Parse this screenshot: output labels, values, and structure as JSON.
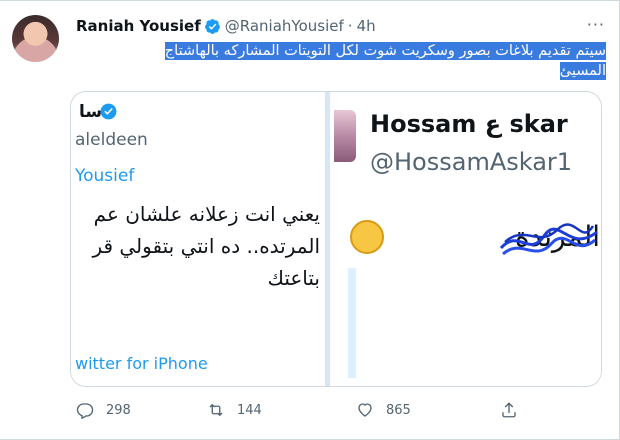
{
  "tweet": {
    "author": {
      "display_name": "Raniah Yousief",
      "handle": "@RaniahYousief",
      "separator": "·",
      "time": "4h",
      "verified": true
    },
    "text": "سيتم تقديم بلاغات بصور وسكريت شوت لكل التويتات المشاركه بالهاشتاج المسيئ",
    "more_label": "···"
  },
  "media": {
    "left_panel": {
      "name_fragment": "سا",
      "handle_fragment": "aleldeen",
      "reply_fragment": "Yousief",
      "body_lines": [
        "يعني انت زعلانه علشان عم",
        "المرتده.. ده انتي بتقولي قر",
        "بتاعتك"
      ],
      "footer_fragment": "witter for iPhone"
    },
    "right_panel": {
      "name": "Hossam ع skar",
      "handle": "@HossamAskar1",
      "text": "المرتدة",
      "emoji": "rolling-on-floor-laughing-icon"
    }
  },
  "actions": {
    "reply_count": "298",
    "retweet_count": "144",
    "like_count": "865"
  },
  "colors": {
    "accent": "#1d9bf0",
    "highlight": "#3a7be0",
    "muted": "#536471"
  }
}
